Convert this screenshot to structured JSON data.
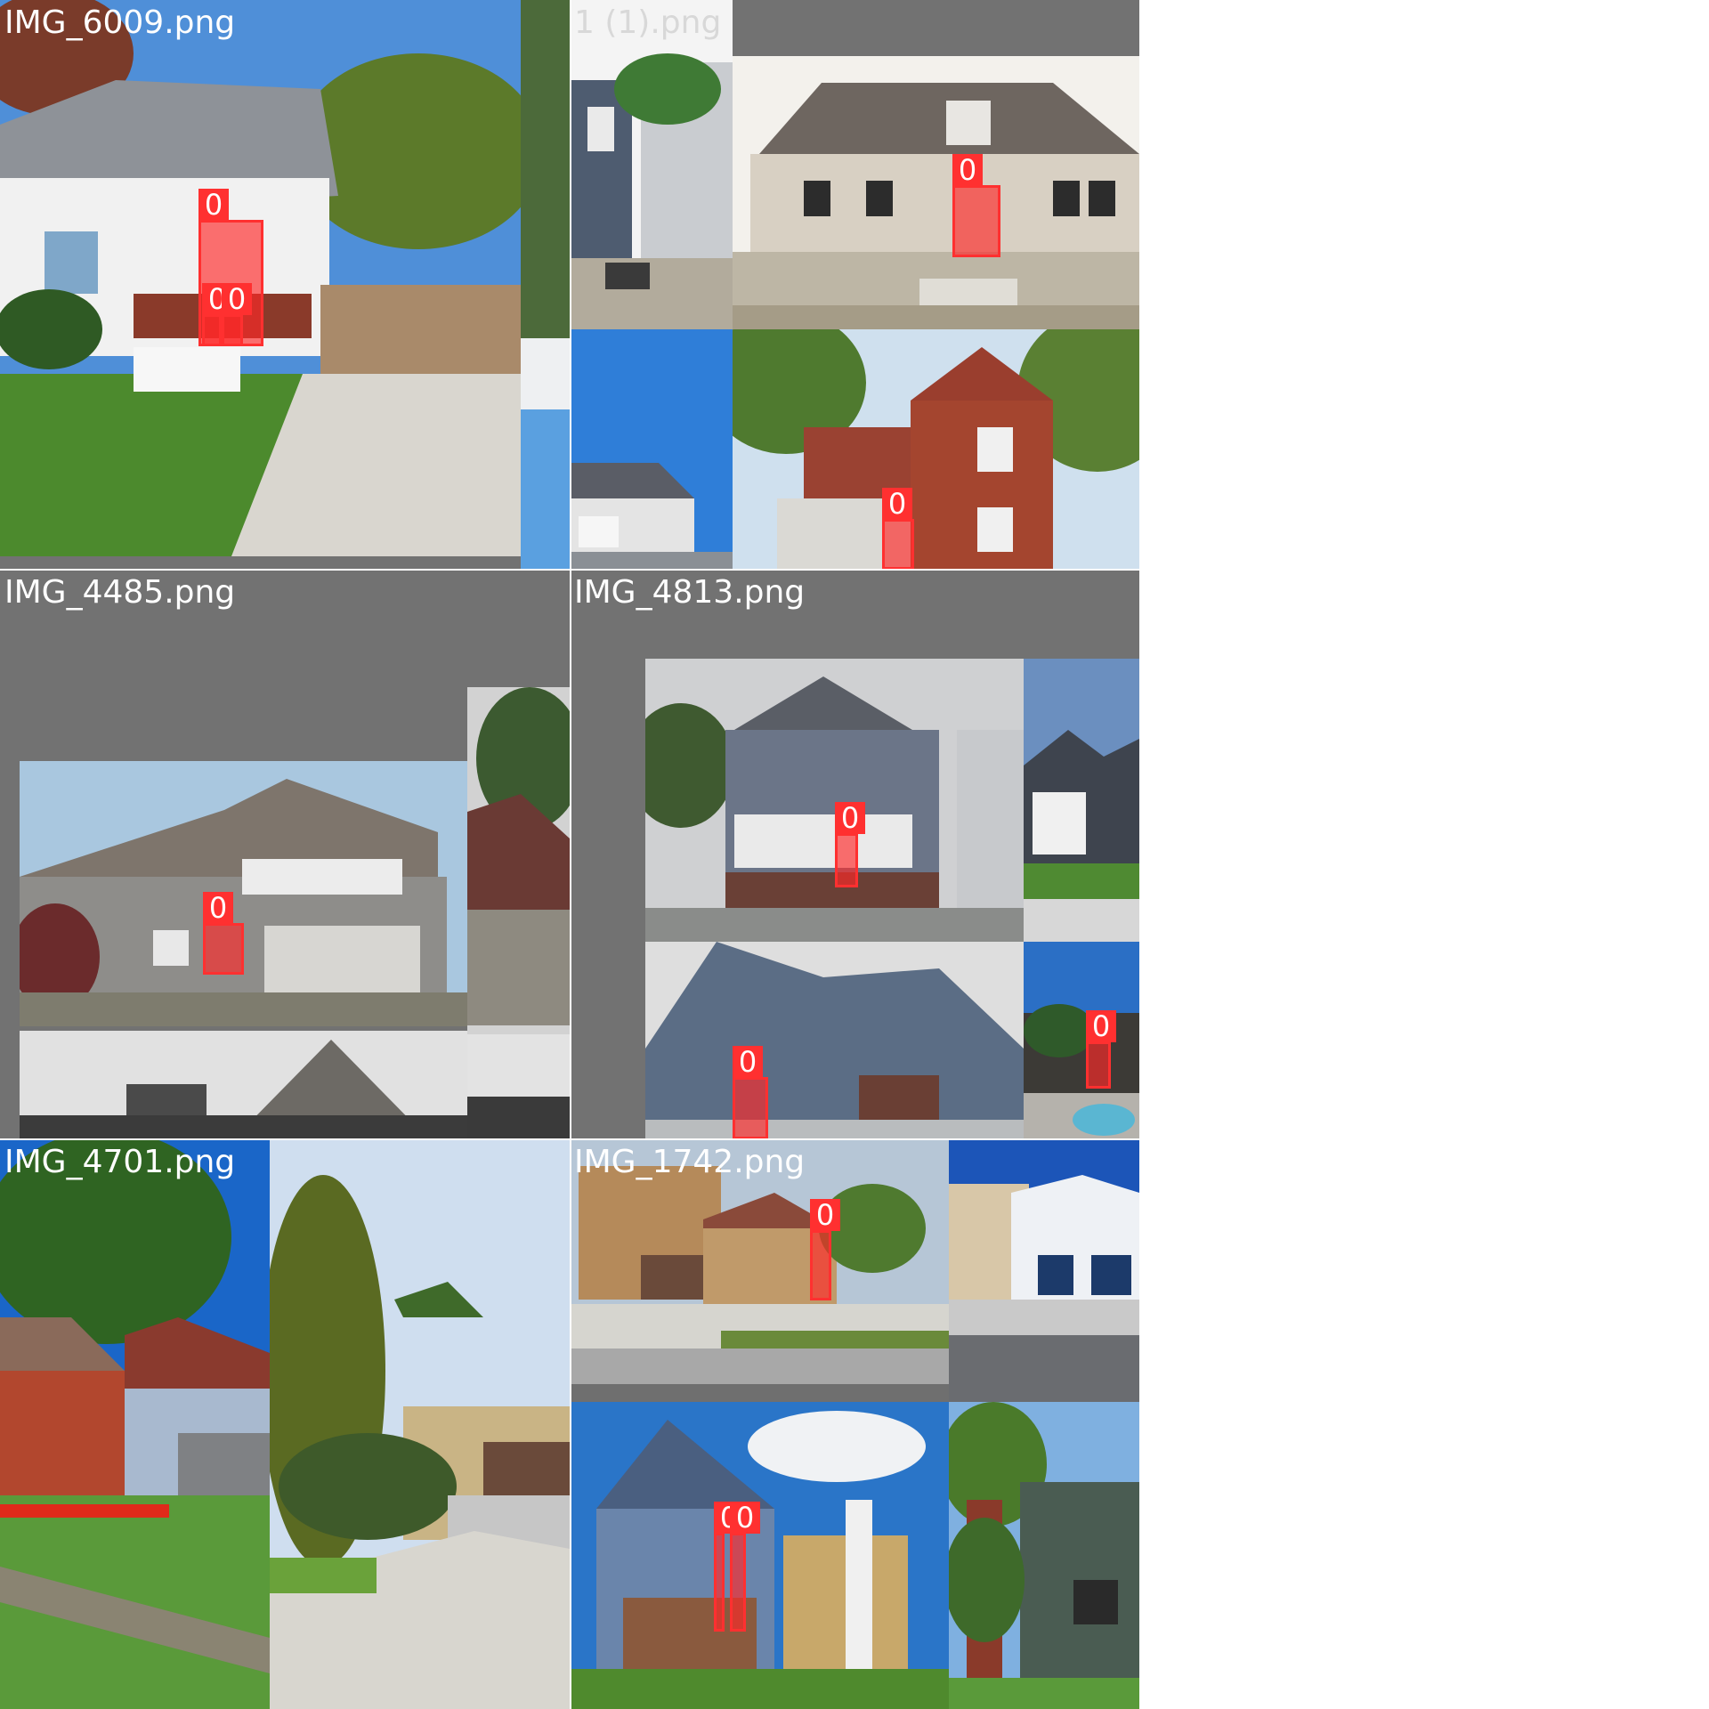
{
  "tiles": [
    {
      "label": "IMG_6009.png",
      "detections": [
        "0",
        "0",
        "0"
      ]
    },
    {
      "label": "1 (1).png",
      "detections": [
        "0",
        "0"
      ]
    },
    {
      "label": "IMG_4485.png",
      "detections": [
        "0"
      ]
    },
    {
      "label": "IMG_4813.png",
      "detections": [
        "0",
        "0",
        "0"
      ]
    },
    {
      "label": "IMG_4701.png",
      "detections": []
    },
    {
      "label": "IMG_1742.png",
      "detections": [
        "0",
        "0",
        "0"
      ]
    }
  ],
  "colors": {
    "box": "#ff3030",
    "padding": "#727272",
    "label": "#ffffff"
  },
  "icons": {
    "photo": "house-photo"
  }
}
